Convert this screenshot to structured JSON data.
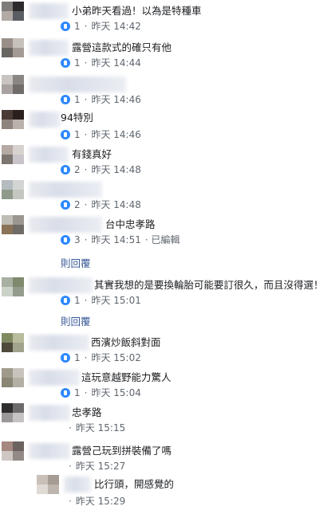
{
  "comments": [
    {
      "text": "小弟昨天看過！以為是特種車",
      "likes": "1",
      "sep": "·",
      "time": "昨天 14:42",
      "edited": ""
    },
    {
      "text": "露營這款式的確只有他",
      "likes": "1",
      "sep": "·",
      "time": "昨天 14:44",
      "edited": ""
    },
    {
      "text": "",
      "likes": "1",
      "sep": "·",
      "time": "昨天 14:46",
      "edited": ""
    },
    {
      "text": "94特別",
      "likes": "1",
      "sep": "·",
      "time": "昨天 14:46",
      "edited": ""
    },
    {
      "text": "有錢真好",
      "likes": "2",
      "sep": "·",
      "time": "昨天 14:48",
      "edited": ""
    },
    {
      "text": "",
      "likes": "2",
      "sep": "·",
      "time": "昨天 14:48",
      "edited": ""
    },
    {
      "text": "台中忠孝路",
      "likes": "3",
      "sep": "·",
      "time": "昨天 14:51",
      "edited": "· 已編輯"
    },
    {
      "text": "其實我想的是要換輪胎可能要訂很久，而且沒得選！",
      "likes": "1",
      "sep": "·",
      "time": "昨天 15:01",
      "edited": ""
    },
    {
      "text": "西濱炒飯斜對面",
      "likes": "1",
      "sep": "·",
      "time": "昨天 15:02",
      "edited": ""
    },
    {
      "text": "這玩意越野能力驚人",
      "likes": "1",
      "sep": "·",
      "time": "昨天 15:04",
      "edited": ""
    },
    {
      "text": "忠孝路",
      "likes": "",
      "sep": "·",
      "time": "昨天 15:15",
      "edited": ""
    },
    {
      "text": "露營己玩到拼裝備了嗎",
      "likes": "",
      "sep": "·",
      "time": "昨天 15:27",
      "edited": ""
    },
    {
      "text": "比行頭，開感覺的",
      "likes": "",
      "sep": "·",
      "time": "昨天 15:29",
      "edited": ""
    }
  ],
  "reply_links": [
    "則回覆",
    "則回覆"
  ],
  "colors": {
    "link": "#385898",
    "meta": "#606770",
    "like": "#2d88ff"
  }
}
